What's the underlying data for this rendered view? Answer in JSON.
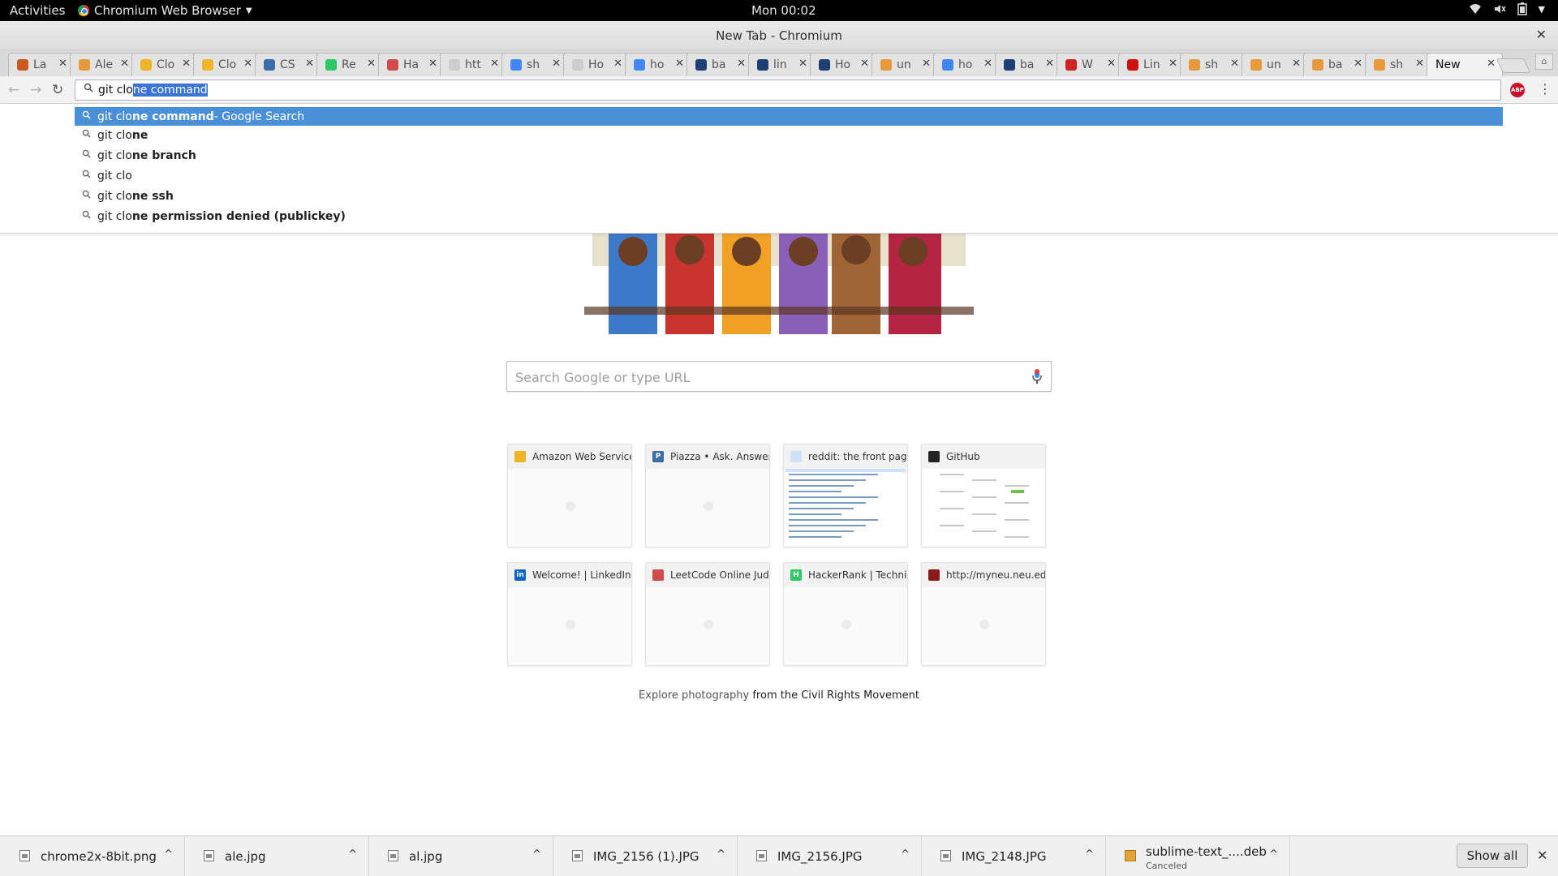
{
  "topbar": {
    "activities": "Activities",
    "app_menu": "Chromium Web Browser",
    "clock": "Mon 00:02"
  },
  "window": {
    "title": "New Tab - Chromium"
  },
  "tabs": [
    {
      "label": "La",
      "fav_color": "#c85a1e"
    },
    {
      "label": "Ale",
      "fav_color": "#e69a3c"
    },
    {
      "label": "Clo",
      "fav_color": "#f0b429"
    },
    {
      "label": "Clo",
      "fav_color": "#f0b429"
    },
    {
      "label": "CS",
      "fav_color": "#3b6ea5"
    },
    {
      "label": "Re",
      "fav_color": "#2ec866"
    },
    {
      "label": "Ha",
      "fav_color": "#d04b4b"
    },
    {
      "label": "htt",
      "fav_color": "#cccccc"
    },
    {
      "label": "sh",
      "fav_color": "#4285f4"
    },
    {
      "label": "Ho",
      "fav_color": "#cccccc"
    },
    {
      "label": "ho",
      "fav_color": "#4285f4"
    },
    {
      "label": "ba",
      "fav_color": "#1d3f72"
    },
    {
      "label": "lin",
      "fav_color": "#1d3f72"
    },
    {
      "label": "Ho",
      "fav_color": "#1d3f72"
    },
    {
      "label": "un",
      "fav_color": "#e69a3c"
    },
    {
      "label": "ho",
      "fav_color": "#4285f4"
    },
    {
      "label": "ba",
      "fav_color": "#1d3f72"
    },
    {
      "label": "W",
      "fav_color": "#cc2222"
    },
    {
      "label": "Lin",
      "fav_color": "#cc1111"
    },
    {
      "label": "sh",
      "fav_color": "#e69a3c"
    },
    {
      "label": "un",
      "fav_color": "#e69a3c"
    },
    {
      "label": "ba",
      "fav_color": "#e69a3c"
    },
    {
      "label": "sh",
      "fav_color": "#e69a3c"
    },
    {
      "label": "New",
      "fav_color": "",
      "active": true
    }
  ],
  "omnibox": {
    "typed": "git clo",
    "autocomplete": "ne command"
  },
  "suggestions": [
    {
      "prefix": "git clo",
      "bold": "ne command",
      "tail": " - Google Search",
      "highlight": true
    },
    {
      "prefix": "git clo",
      "bold": "ne",
      "tail": ""
    },
    {
      "prefix": "git clo",
      "bold": "ne branch",
      "tail": ""
    },
    {
      "prefix": "git clo",
      "bold": "",
      "tail": ""
    },
    {
      "prefix": "git clo",
      "bold": "ne ssh",
      "tail": ""
    },
    {
      "prefix": "git clo",
      "bold": "ne permission denied (publickey)",
      "tail": ""
    }
  ],
  "search": {
    "placeholder": "Search Google or type URL"
  },
  "tiles": [
    {
      "title": "Amazon Web Services",
      "icon": "aws-icon",
      "fav_color": "#f0b429",
      "fav_text": ""
    },
    {
      "title": "Piazza • Ask. Answer",
      "icon": "piazza-icon",
      "fav_color": "#3b6ea5",
      "fav_text": "P"
    },
    {
      "title": "reddit: the front page",
      "icon": "reddit-icon",
      "fav_color": "#cee3f8",
      "fav_text": ""
    },
    {
      "title": "GitHub",
      "icon": "github-icon",
      "fav_color": "#222222",
      "fav_text": ""
    },
    {
      "title": "Welcome! | LinkedIn",
      "icon": "linkedin-icon",
      "fav_color": "#0a66c2",
      "fav_text": "in"
    },
    {
      "title": "LeetCode Online Judge",
      "icon": "leetcode-icon",
      "fav_color": "#d04b4b",
      "fav_text": ""
    },
    {
      "title": "HackerRank | Technical",
      "icon": "hackerrank-icon",
      "fav_color": "#2ec866",
      "fav_text": "H"
    },
    {
      "title": "http://myneu.neu.edu",
      "icon": "paw-icon",
      "fav_color": "#8b1a1a",
      "fav_text": ""
    }
  ],
  "explore": {
    "text": "Explore photography",
    "link": "from the Civil Rights Movement"
  },
  "downloads": [
    {
      "name": "chrome2x-8bit.png",
      "status": ""
    },
    {
      "name": "ale.jpg",
      "status": ""
    },
    {
      "name": "al.jpg",
      "status": ""
    },
    {
      "name": "IMG_2156 (1).JPG",
      "status": ""
    },
    {
      "name": "IMG_2156.JPG",
      "status": ""
    },
    {
      "name": "IMG_2148.JPG",
      "status": ""
    },
    {
      "name": "sublime-text_....deb",
      "status": "Canceled"
    }
  ],
  "download_shelf": {
    "show_all": "Show all"
  },
  "colors": {
    "highlight": "#4a90d9",
    "selection": "#3875d7",
    "abp": "#c70d2c"
  }
}
